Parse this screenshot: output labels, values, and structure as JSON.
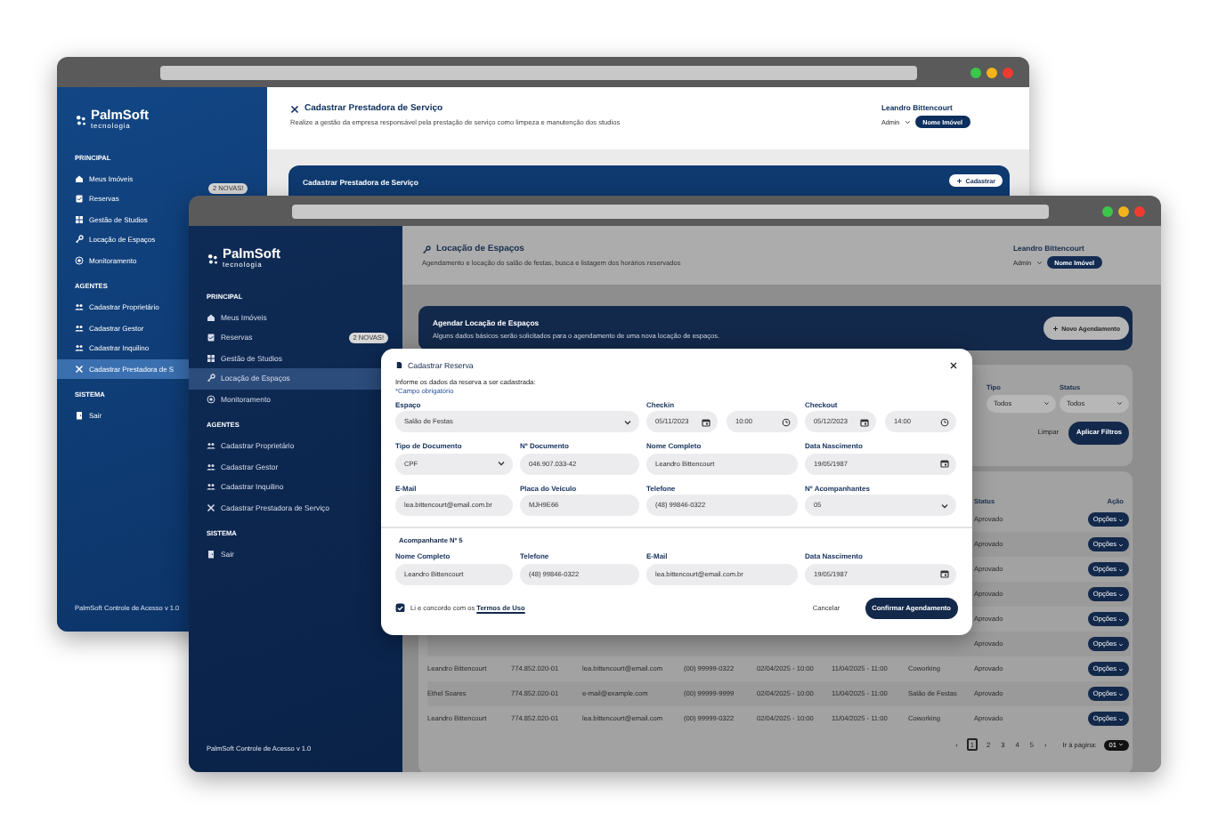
{
  "back_window": {
    "sidebar": {
      "logo": "PalmSoft",
      "logo_sub": "tecnologia",
      "sections": [
        {
          "title": "PRINCIPAL",
          "items": [
            {
              "label": "Meus Imóveis",
              "selected": false
            },
            {
              "label": "Reservas",
              "selected": false,
              "badge": "2 NOVAS!"
            },
            {
              "label": "Gestão de Studios",
              "selected": false
            },
            {
              "label": "Locação de Espaços",
              "selected": false
            },
            {
              "label": "Monitoramento",
              "selected": false
            }
          ]
        },
        {
          "title": "AGENTES",
          "items": [
            {
              "label": "Cadastrar Proprietário",
              "selected": false
            },
            {
              "label": "Cadastrar Gestor",
              "selected": false
            },
            {
              "label": "Cadastrar Inquilino",
              "selected": false
            },
            {
              "label": "Cadastrar Prestadora de S",
              "selected": true
            }
          ]
        },
        {
          "title": "SISTEMA",
          "items": [
            {
              "label": "Sair",
              "selected": false
            }
          ]
        }
      ],
      "footer": "PalmSoft Controle de Acesso v 1.0"
    },
    "header": {
      "title": "Cadastrar Prestadora de Serviço",
      "subtitle": "Realize a gestão da empresa responsável pela prestação de serviço como limpeza e manutenção dos studios",
      "user": "Leandro Bittencourt",
      "role": "Admin",
      "property": "Nome Imóvel"
    },
    "card": {
      "title": "Cadastrar Prestadora de Serviço",
      "button": "Cadastrar"
    }
  },
  "front_window": {
    "sidebar": {
      "logo": "PalmSoft",
      "logo_sub": "tecnologia",
      "sections": [
        {
          "title": "PRINCIPAL",
          "items": [
            {
              "label": "Meus Imóveis",
              "selected": false
            },
            {
              "label": "Reservas",
              "selected": false,
              "badge": "2 NOVAS!"
            },
            {
              "label": "Gestão de Studios",
              "selected": false
            },
            {
              "label": "Locação de Espaços",
              "selected": true
            },
            {
              "label": "Monitoramento",
              "selected": false
            }
          ]
        },
        {
          "title": "AGENTES",
          "items": [
            {
              "label": "Cadastrar Proprietário",
              "selected": false
            },
            {
              "label": "Cadastrar Gestor",
              "selected": false
            },
            {
              "label": "Cadastrar Inquilino",
              "selected": false
            },
            {
              "label": "Cadastrar Prestadora de Serviço",
              "selected": false
            }
          ]
        },
        {
          "title": "SISTEMA",
          "items": [
            {
              "label": "Sair",
              "selected": false
            }
          ]
        }
      ],
      "footer": "PalmSoft Controle de Acesso v 1.0"
    },
    "header": {
      "title": "Locação de Espaços",
      "subtitle": "Agendamento e locação do salão de festas, busca e listagem dos horários reservados",
      "user": "Leandro Bittencourt",
      "role": "Admin",
      "property": "Nome Imóvel"
    },
    "card": {
      "title": "Agendar Locação de Espaços",
      "text": "Alguns dados básicos serão solicitados para o agendamento de uma nova locação de espaços.",
      "button": "Novo Agendamento"
    },
    "filters": {
      "fields": [
        {
          "label": "Tipo",
          "value": "Todos"
        },
        {
          "label": "Status",
          "value": "Todos"
        }
      ],
      "clear": "Limpar",
      "apply": "Aplicar Filtros"
    },
    "table": {
      "columns": [
        {
          "label": "Status"
        },
        {
          "label": "Ação"
        }
      ],
      "rows": [
        {
          "status": "Aprovado",
          "action": "Opções"
        },
        {
          "status": "Aprovado",
          "action": "Opções"
        },
        {
          "status": "Aprovado",
          "action": "Opções"
        },
        {
          "status": "Aprovado",
          "action": "Opções"
        },
        {
          "status": "Aprovado",
          "action": "Opções"
        },
        {
          "status": "Aprovado",
          "action": "Opções"
        },
        {
          "column_1": "Leandro Bittencourt",
          "column_2": "774.852.020-01",
          "column_3": "lea.bittencourt@email.com",
          "column_4": "(00) 99999-0322",
          "column_5": "02/04/2025 - 10:00",
          "column_6": "11/04/2025 - 11:00",
          "column_7": "Coworking",
          "status": "Aprovado",
          "action": "Opções"
        },
        {
          "column_1": "Ethel Soares",
          "column_2": "774.852.020-01",
          "column_3": "e-mail@example.com",
          "column_4": "(00) 99999-9999",
          "column_5": "02/04/2025 - 10:00",
          "column_6": "11/04/2025 - 11:00",
          "column_7": "Salão de Festas",
          "status": "Aprovado",
          "action": "Opções"
        },
        {
          "column_1": "Leandro Bittencourt",
          "column_2": "774.852.020-01",
          "column_3": "lea.bittencourt@email.com",
          "column_4": "(00) 99999-0322",
          "column_5": "02/04/2025 - 10:00",
          "column_6": "11/04/2025 - 11:00",
          "column_7": "Coworking",
          "status": "Aprovado",
          "action": "Opções"
        }
      ]
    },
    "pagination": {
      "prev": "‹",
      "next": "›",
      "pages": [
        {
          "label": "1",
          "selected": true
        },
        {
          "label": "2",
          "selected": false
        },
        {
          "label": "3",
          "selected": false
        },
        {
          "label": "4",
          "selected": false
        },
        {
          "label": "5",
          "selected": false
        }
      ],
      "goto_label": "Ir à página:",
      "goto_value": "01"
    }
  },
  "modal": {
    "title": "Cadastrar Reserva",
    "intro": "Informe os dados da reserva a ser cadastrada:",
    "required_note": "*Campo obrigatório",
    "space": {
      "label": "Espaço",
      "value": "Salão de Festas"
    },
    "checkin": {
      "label": "Checkin",
      "date": "05/11/2023",
      "time": "10:00"
    },
    "checkout": {
      "label": "Checkout",
      "date": "05/12/2023",
      "time": "14:00"
    },
    "fields": [
      {
        "label": "Tipo de Documento",
        "value": "CPF",
        "kind": "select"
      },
      {
        "label": "Nº Documento",
        "value": "046.907.033-42",
        "kind": "text"
      },
      {
        "label": "Nome Completo",
        "value": "Leandro Bittencourt",
        "kind": "text"
      },
      {
        "label": "Data Nascimento",
        "value": "19/05/1987",
        "kind": "date"
      },
      {
        "label": "E-Mail",
        "value": "lea.bittencourt@email.com.br",
        "kind": "text"
      },
      {
        "label": "Placa do Veículo",
        "value": "MJH9E66",
        "kind": "text"
      },
      {
        "label": "Telefone",
        "value": "(48) 99846-0322",
        "kind": "text"
      },
      {
        "label": "Nº Acompanhantes",
        "value": "05",
        "kind": "select"
      }
    ],
    "companion": {
      "title": "Acompanhante Nº 5",
      "fields": [
        {
          "label": "Nome Completo",
          "value": "Leandro Bittencourt",
          "kind": "text"
        },
        {
          "label": "Telefone",
          "value": "(48) 99846-0322",
          "kind": "text"
        },
        {
          "label": "E-Mail",
          "value": "lea.bittencourt@email.com.br",
          "kind": "text"
        },
        {
          "label": "Data Nascimento",
          "value": "19/05/1987",
          "kind": "date"
        }
      ]
    },
    "terms": {
      "text": "Li e concordo com os",
      "link": "Termos de Uso",
      "agreed": true
    },
    "cancel": "Cancelar",
    "confirm": "Confirmar Agendamento"
  }
}
